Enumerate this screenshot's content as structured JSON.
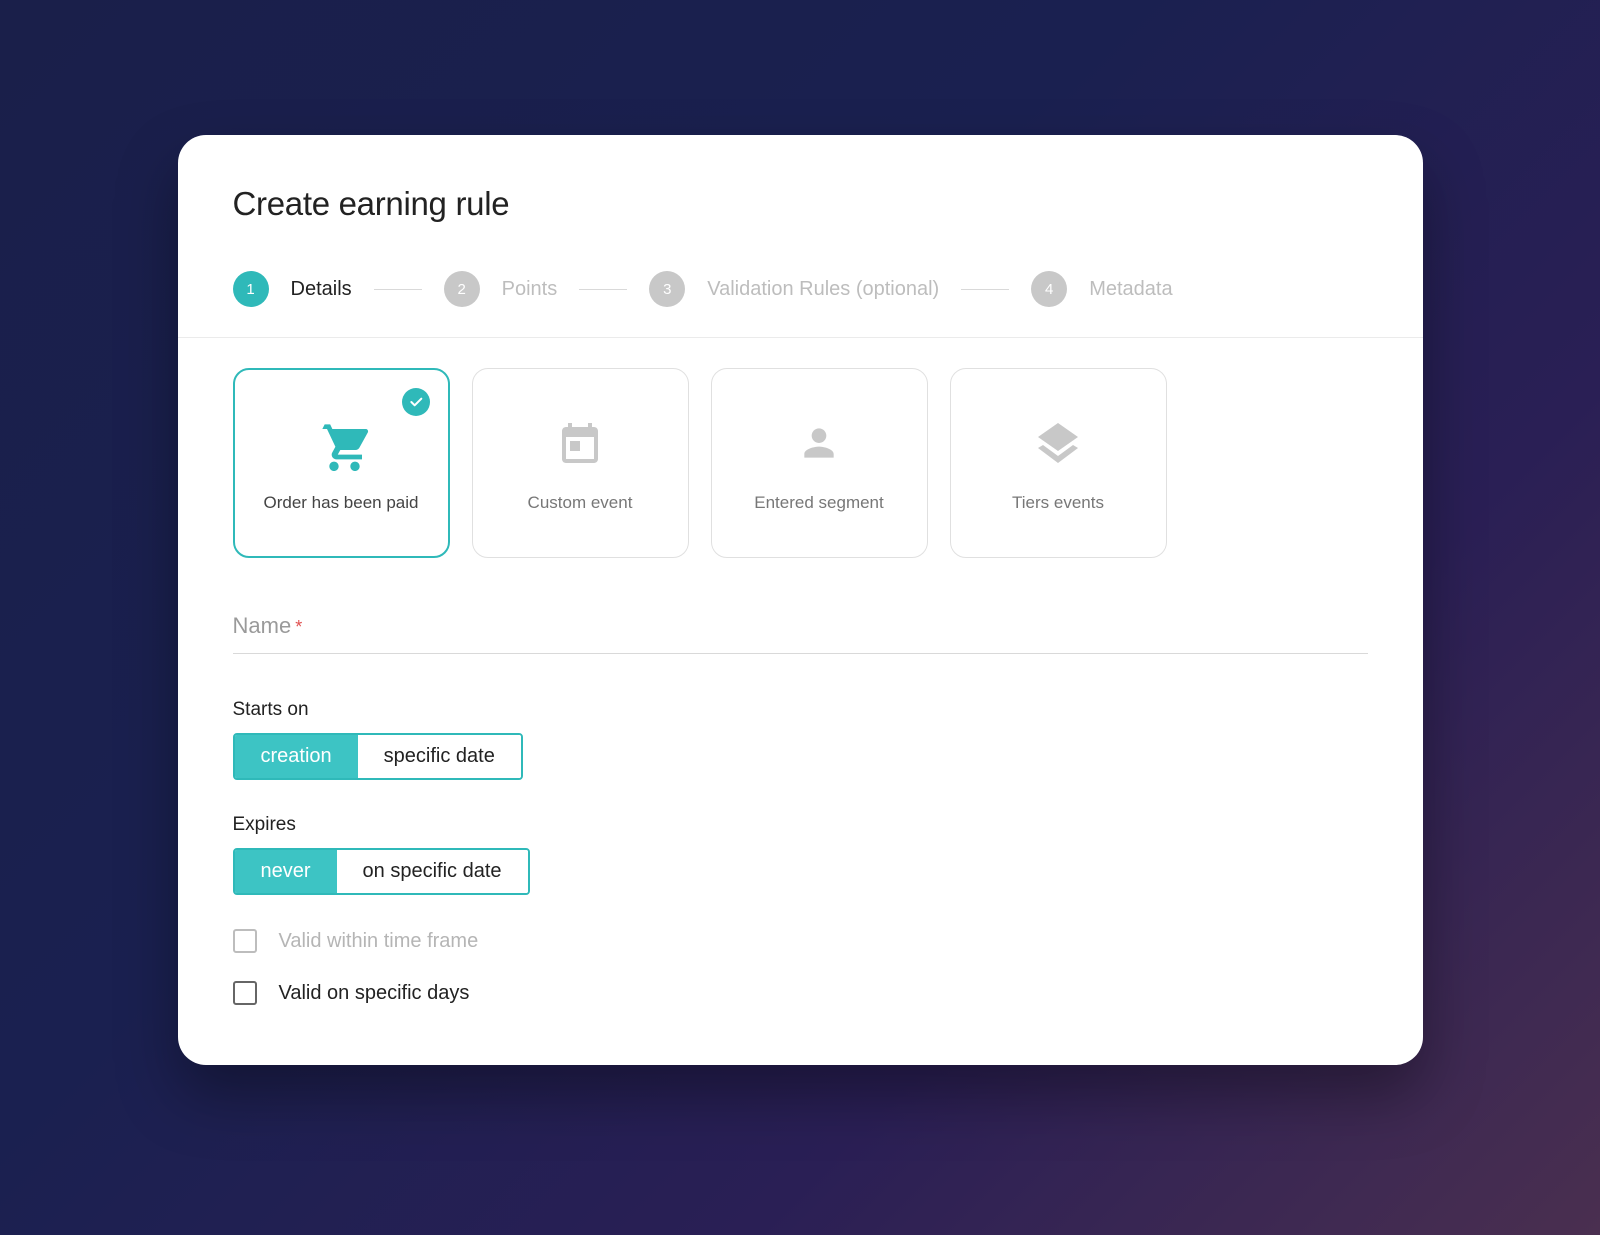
{
  "title": "Create earning rule",
  "steps": [
    {
      "num": "1",
      "label": "Details",
      "active": true
    },
    {
      "num": "2",
      "label": "Points",
      "active": false
    },
    {
      "num": "3",
      "label": "Validation Rules (optional)",
      "active": false
    },
    {
      "num": "4",
      "label": "Metadata",
      "active": false
    }
  ],
  "eventTypes": [
    {
      "label": "Order has been paid",
      "icon": "cart",
      "selected": true
    },
    {
      "label": "Custom event",
      "icon": "calendar",
      "selected": false
    },
    {
      "label": "Entered segment",
      "icon": "person",
      "selected": false
    },
    {
      "label": "Tiers events",
      "icon": "layers",
      "selected": false
    }
  ],
  "form": {
    "nameLabel": "Name",
    "nameValue": "",
    "startsOn": {
      "label": "Starts on",
      "options": [
        "creation",
        "specific date"
      ],
      "selected": "creation"
    },
    "expires": {
      "label": "Expires",
      "options": [
        "never",
        "on specific date"
      ],
      "selected": "never"
    },
    "validTimeFrame": {
      "label": "Valid within time frame",
      "checked": false,
      "muted": true
    },
    "validSpecificDays": {
      "label": "Valid on specific days",
      "checked": false,
      "muted": false
    }
  }
}
